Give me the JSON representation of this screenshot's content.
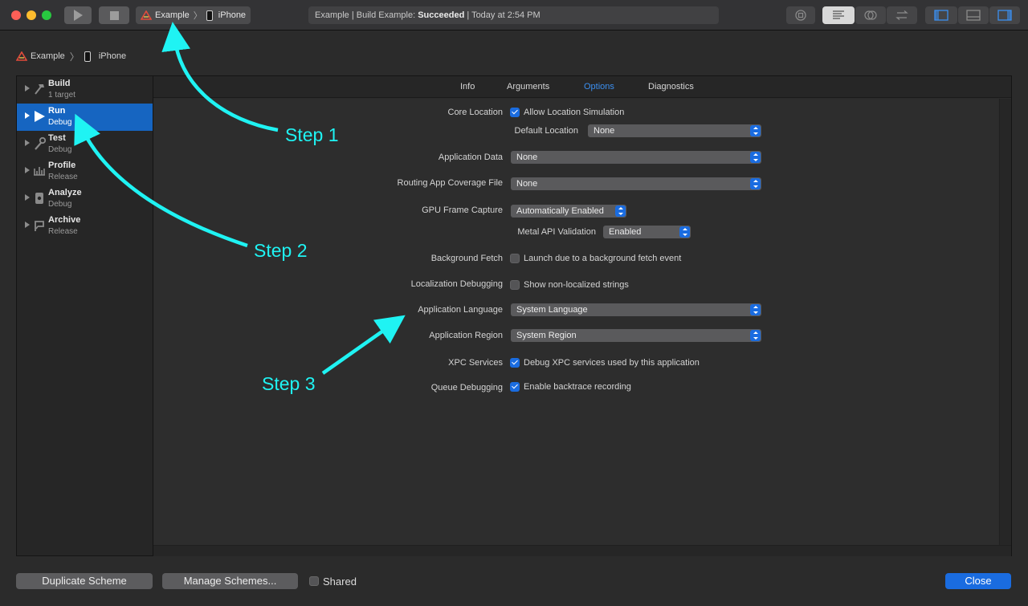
{
  "toolbar": {
    "scheme_name": "Example",
    "destination": "iPhone",
    "status_project": "Example | Build Example: ",
    "status_result": "Succeeded",
    "status_time": " | Today at 2:54 PM"
  },
  "breadcrumb": {
    "scheme": "Example",
    "destination": "iPhone"
  },
  "sidebar": {
    "items": [
      {
        "title": "Build",
        "subtitle": "1 target",
        "icon": "hammer-icon"
      },
      {
        "title": "Run",
        "subtitle": "Debug",
        "icon": "play-icon"
      },
      {
        "title": "Test",
        "subtitle": "Debug",
        "icon": "wrench-icon"
      },
      {
        "title": "Profile",
        "subtitle": "Release",
        "icon": "gauge-icon"
      },
      {
        "title": "Analyze",
        "subtitle": "Debug",
        "icon": "analyze-icon"
      },
      {
        "title": "Archive",
        "subtitle": "Release",
        "icon": "archive-icon"
      }
    ],
    "selected_index": 1
  },
  "tabs": [
    {
      "label": "Info"
    },
    {
      "label": "Arguments"
    },
    {
      "label": "Options"
    },
    {
      "label": "Diagnostics"
    }
  ],
  "active_tab": "Options",
  "options": {
    "core_location": {
      "label": "Core Location",
      "checkbox_label": "Allow Location Simulation",
      "checked": true
    },
    "default_location": {
      "label": "Default Location",
      "value": "None"
    },
    "application_data": {
      "label": "Application Data",
      "value": "None"
    },
    "routing_file": {
      "label": "Routing App Coverage File",
      "value": "None"
    },
    "gpu_frame_capture": {
      "label": "GPU Frame Capture",
      "value": "Automatically Enabled"
    },
    "metal_api": {
      "label": "Metal API Validation",
      "value": "Enabled"
    },
    "background_fetch": {
      "label": "Background Fetch",
      "checkbox_label": "Launch due to a background fetch event",
      "checked": false
    },
    "localization_debugging": {
      "label": "Localization Debugging",
      "checkbox_label": "Show non-localized strings",
      "checked": false
    },
    "app_language": {
      "label": "Application Language",
      "value": "System Language"
    },
    "app_region": {
      "label": "Application Region",
      "value": "System Region"
    },
    "xpc_services": {
      "label": "XPC Services",
      "checkbox_label": "Debug XPC services used by this application",
      "checked": true
    },
    "queue_debugging": {
      "label": "Queue Debugging",
      "checkbox_label": "Enable backtrace recording",
      "checked": true
    }
  },
  "footer": {
    "duplicate": "Duplicate Scheme",
    "manage": "Manage Schemes...",
    "shared": "Shared",
    "close": "Close"
  },
  "annotations": {
    "step1": "Step 1",
    "step2": "Step 2",
    "step3": "Step 3"
  },
  "colors": {
    "accent": "#1a6ce0",
    "selection": "#1665c1",
    "annotation": "#1ff3f3",
    "tab_active": "#3b8ff0"
  }
}
